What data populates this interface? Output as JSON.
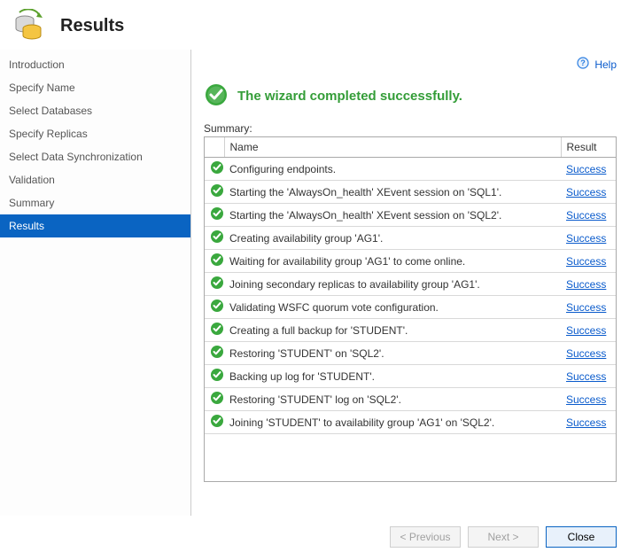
{
  "header": {
    "title": "Results"
  },
  "help": {
    "label": "Help"
  },
  "sidebar": {
    "items": [
      {
        "label": "Introduction"
      },
      {
        "label": "Specify Name"
      },
      {
        "label": "Select Databases"
      },
      {
        "label": "Specify Replicas"
      },
      {
        "label": "Select Data Synchronization"
      },
      {
        "label": "Validation"
      },
      {
        "label": "Summary"
      },
      {
        "label": "Results"
      }
    ],
    "selected_index": 7
  },
  "status": {
    "message": "The wizard completed successfully."
  },
  "summary": {
    "label": "Summary:",
    "columns": {
      "name": "Name",
      "result": "Result"
    },
    "rows": [
      {
        "name": "Configuring endpoints.",
        "result": "Success"
      },
      {
        "name": "Starting the 'AlwaysOn_health' XEvent session on 'SQL1'.",
        "result": "Success"
      },
      {
        "name": "Starting the 'AlwaysOn_health' XEvent session on 'SQL2'.",
        "result": "Success"
      },
      {
        "name": "Creating availability group 'AG1'.",
        "result": "Success"
      },
      {
        "name": "Waiting for availability group 'AG1' to come online.",
        "result": "Success"
      },
      {
        "name": "Joining secondary replicas to availability group 'AG1'.",
        "result": "Success"
      },
      {
        "name": "Validating WSFC quorum vote configuration.",
        "result": "Success"
      },
      {
        "name": "Creating a full backup for 'STUDENT'.",
        "result": "Success"
      },
      {
        "name": "Restoring 'STUDENT' on 'SQL2'.",
        "result": "Success"
      },
      {
        "name": "Backing up log for 'STUDENT'.",
        "result": "Success"
      },
      {
        "name": "Restoring 'STUDENT' log on 'SQL2'.",
        "result": "Success"
      },
      {
        "name": "Joining 'STUDENT' to availability group 'AG1' on 'SQL2'.",
        "result": "Success"
      }
    ]
  },
  "footer": {
    "previous": "< Previous",
    "next": "Next >",
    "close": "Close"
  },
  "icons": {
    "database": "database-sync-icon",
    "help": "help-icon",
    "success_large": "success-check-large-icon",
    "success_small": "success-check-small-icon"
  },
  "colors": {
    "accent_blue": "#0a64c2",
    "link_blue": "#0a5bcc",
    "success_green": "#349d38"
  }
}
